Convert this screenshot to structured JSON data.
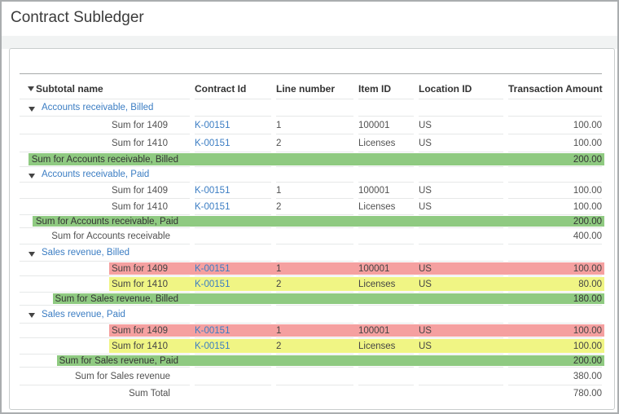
{
  "title": "Contract Subledger",
  "colors": {
    "green": "#8fca81",
    "red": "#f5a0a0",
    "yellow": "#f0f584",
    "link": "#3b7dc3"
  },
  "icons": {
    "header_sort": "sort-descending-icon",
    "group_collapse": "collapse-group-icon"
  },
  "table": {
    "columns": [
      "Subtotal name",
      "Contract Id",
      "Line number",
      "Item ID",
      "Location ID",
      "Transaction Amount"
    ],
    "rows": [
      {
        "type": "group",
        "label": "Accounts receivable, Billed"
      },
      {
        "type": "detail",
        "label": "Sum for 1409",
        "contract_id": "K-00151",
        "line_number": "1",
        "item_id": "100001",
        "location_id": "US",
        "amount": "100.00",
        "highlight": null
      },
      {
        "type": "detail",
        "label": "Sum for 1410",
        "contract_id": "K-00151",
        "line_number": "2",
        "item_id": "Licenses",
        "location_id": "US",
        "amount": "100.00",
        "highlight": null
      },
      {
        "type": "subtotal",
        "label": "Sum for Accounts receivable, Billed",
        "amount": "200.00",
        "highlight": "green"
      },
      {
        "type": "group",
        "label": "Accounts receivable, Paid"
      },
      {
        "type": "detail",
        "label": "Sum for 1409",
        "contract_id": "K-00151",
        "line_number": "1",
        "item_id": "100001",
        "location_id": "US",
        "amount": "100.00",
        "highlight": null
      },
      {
        "type": "detail",
        "label": "Sum for 1410",
        "contract_id": "K-00151",
        "line_number": "2",
        "item_id": "Licenses",
        "location_id": "US",
        "amount": "100.00",
        "highlight": null
      },
      {
        "type": "subtotal",
        "label": "Sum for Accounts receivable, Paid",
        "amount": "200.00",
        "highlight": "green"
      },
      {
        "type": "plain",
        "label": "Sum for Accounts receivable",
        "amount": "400.00",
        "highlight": null
      },
      {
        "type": "group",
        "label": "Sales revenue, Billed"
      },
      {
        "type": "detail",
        "label": "Sum for 1409",
        "contract_id": "K-00151",
        "line_number": "1",
        "item_id": "100001",
        "location_id": "US",
        "amount": "100.00",
        "highlight": "red"
      },
      {
        "type": "detail",
        "label": "Sum for 1410",
        "contract_id": "K-00151",
        "line_number": "2",
        "item_id": "Licenses",
        "location_id": "US",
        "amount": "80.00",
        "highlight": "yellow"
      },
      {
        "type": "subtotal",
        "label": "Sum for Sales revenue, Billed",
        "amount": "180.00",
        "highlight": "green"
      },
      {
        "type": "group",
        "label": "Sales revenue, Paid"
      },
      {
        "type": "detail",
        "label": "Sum for 1409",
        "contract_id": "K-00151",
        "line_number": "1",
        "item_id": "100001",
        "location_id": "US",
        "amount": "100.00",
        "highlight": "red"
      },
      {
        "type": "detail",
        "label": "Sum for 1410",
        "contract_id": "K-00151",
        "line_number": "2",
        "item_id": "Licenses",
        "location_id": "US",
        "amount": "100.00",
        "highlight": "yellow"
      },
      {
        "type": "subtotal",
        "label": "Sum for Sales revenue, Paid",
        "amount": "200.00",
        "highlight": "green"
      },
      {
        "type": "plain",
        "label": "Sum for Sales revenue",
        "amount": "380.00",
        "highlight": null
      },
      {
        "type": "plain",
        "label": "Sum Total",
        "amount": "780.00",
        "highlight": null
      }
    ]
  }
}
